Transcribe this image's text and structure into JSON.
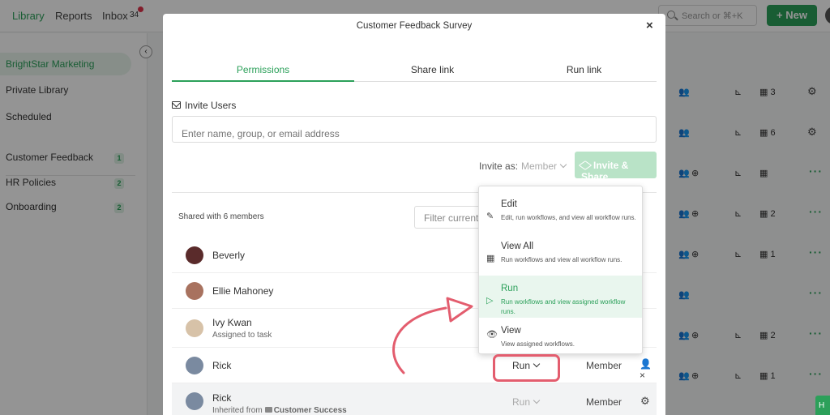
{
  "topbar": {
    "nav": [
      {
        "label": "Library",
        "active": true
      },
      {
        "label": "Reports",
        "active": false
      },
      {
        "label": "Inbox",
        "active": false
      }
    ],
    "inbox_count": "34",
    "search_placeholder": "Search or ⌘+K",
    "new_button": "New"
  },
  "sidebar": {
    "workspace": "BrightStar Marketing",
    "items": [
      "Private Library",
      "Scheduled"
    ],
    "folders": [
      {
        "label": "Customer Feedback",
        "count": "1"
      },
      {
        "label": "HR Policies",
        "count": "2"
      },
      {
        "label": "Onboarding",
        "count": "2"
      }
    ]
  },
  "background_rows": [
    {
      "count": "3",
      "action": "cog"
    },
    {
      "count": "6",
      "action": "cog"
    },
    {
      "count": "",
      "action": "dots"
    },
    {
      "count": "2",
      "action": "dots"
    },
    {
      "count": "1",
      "action": "dots"
    },
    {
      "count": "",
      "action": "dots"
    },
    {
      "count": "2",
      "action": "dots"
    },
    {
      "count": "1",
      "action": "dots"
    }
  ],
  "modal": {
    "title": "Customer Feedback Survey",
    "tabs": [
      "Permissions",
      "Share link",
      "Run link"
    ],
    "active_tab": "Permissions",
    "invite": {
      "label": "Invite Users",
      "placeholder": "Enter name, group, or email address",
      "invite_as_label": "Invite as:",
      "invite_as_value": "Member",
      "button": "Invite & Share"
    },
    "shared_label": "Shared with 6 members",
    "filter_placeholder": "Filter current",
    "members": [
      {
        "name": "Beverly",
        "sub": "",
        "avatar_color": "#5a2b2b"
      },
      {
        "name": "Ellie Mahoney",
        "sub": "",
        "avatar_color": "#a8725f"
      },
      {
        "name": "Ivy Kwan",
        "sub": "Assigned to task",
        "avatar_color": "#d7c2a8"
      },
      {
        "name": "Rick",
        "sub": "",
        "permission": "Run",
        "role": "Member",
        "avatar_color": "#7a8aa0"
      },
      {
        "name": "Rick",
        "sub_prefix": "Inherited from",
        "sub_group": "Customer Success",
        "permission": "Run",
        "role": "Member",
        "avatar_color": "#7a8aa0"
      }
    ]
  },
  "permission_dropdown": {
    "selected": "Run",
    "options": [
      {
        "title": "Edit",
        "desc": "Edit, run workflows, and view all workflow runs.",
        "icon": "pencil-square-icon"
      },
      {
        "title": "View All",
        "desc": "Run workflows and view all workflow runs.",
        "icon": "table-icon"
      },
      {
        "title": "Run",
        "desc": "Run workflows and view assigned workflow runs.",
        "icon": "play-icon"
      },
      {
        "title": "View",
        "desc": "View assigned workflows.",
        "icon": "eye-icon"
      }
    ]
  },
  "colors": {
    "accent": "#2ca05a",
    "annotation": "#e35d6e"
  }
}
